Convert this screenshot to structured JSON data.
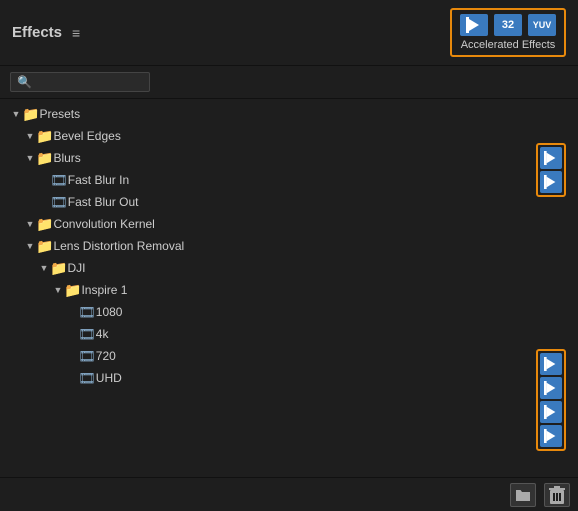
{
  "panel": {
    "title": "Effects",
    "hamburger": "≡",
    "search_placeholder": ""
  },
  "accel_group": {
    "label": "Accelerated Effects",
    "icon1": "▶",
    "icon2": "32",
    "icon3": "YUV"
  },
  "tree": [
    {
      "id": "presets",
      "level": 1,
      "chevron": "down",
      "icon": "folder-star",
      "label": "Presets",
      "accel": false
    },
    {
      "id": "bevel-edges",
      "level": 2,
      "chevron": "down",
      "icon": "folder-star",
      "label": "Bevel Edges",
      "accel": false
    },
    {
      "id": "blurs",
      "level": 2,
      "chevron": "down",
      "icon": "folder-star",
      "label": "Blurs",
      "accel": false
    },
    {
      "id": "fast-blur-in",
      "level": 3,
      "chevron": "none",
      "icon": "film",
      "label": "Fast Blur In",
      "accel": true
    },
    {
      "id": "fast-blur-out",
      "level": 3,
      "chevron": "none",
      "icon": "film",
      "label": "Fast Blur Out",
      "accel": true
    },
    {
      "id": "convolution-kernel",
      "level": 2,
      "chevron": "down",
      "icon": "folder-star",
      "label": "Convolution Kernel",
      "accel": false
    },
    {
      "id": "lens-distortion",
      "level": 2,
      "chevron": "down",
      "icon": "folder-star",
      "label": "Lens Distortion Removal",
      "accel": false
    },
    {
      "id": "dji",
      "level": 3,
      "chevron": "down",
      "icon": "folder-star",
      "label": "DJI",
      "accel": false
    },
    {
      "id": "inspire-1",
      "level": 4,
      "chevron": "down",
      "icon": "folder-star",
      "label": "Inspire 1",
      "accel": false
    },
    {
      "id": "1080",
      "level": 5,
      "chevron": "none",
      "icon": "film",
      "label": "1080",
      "accel": true
    },
    {
      "id": "4k",
      "level": 5,
      "chevron": "none",
      "icon": "film",
      "label": "4k",
      "accel": true
    },
    {
      "id": "720",
      "level": 5,
      "chevron": "none",
      "icon": "film",
      "label": "720",
      "accel": true
    },
    {
      "id": "uhd",
      "level": 5,
      "chevron": "none",
      "icon": "film",
      "label": "UHD",
      "accel": true
    }
  ],
  "bottom_bar": {
    "folder_btn_label": "📁",
    "delete_btn_label": "🗑"
  }
}
